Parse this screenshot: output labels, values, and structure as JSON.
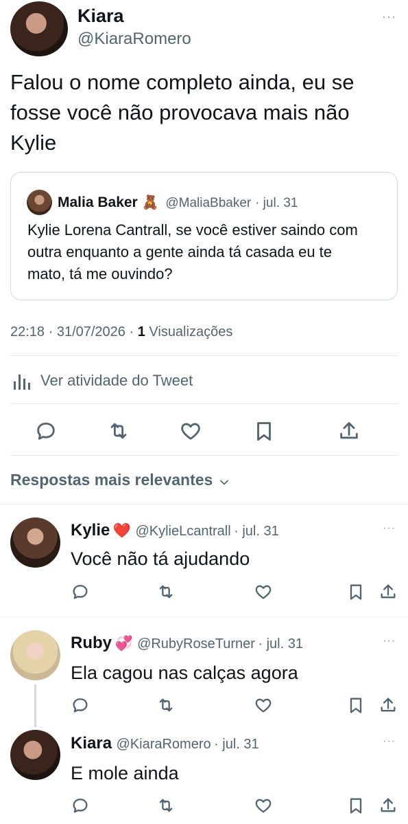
{
  "main_tweet": {
    "author_name": "Kiara",
    "author_handle": "@KiaraRomero",
    "text": "Falou o nome completo ainda, eu se fosse você não provocava mais não Kylie",
    "quoted": {
      "author_name": "Malia Baker",
      "author_emoji": "🧸",
      "author_handle": "@MaliaBbaker",
      "date": "· jul. 31",
      "text": "Kylie Lorena Cantrall, se você estiver saindo com outra enquanto a gente ainda tá casada eu te mato, tá me ouvindo?"
    },
    "timestamp": "22:18 · 31/07/2026 ·",
    "views_count": "1",
    "views_label": "Visualizações",
    "activity_label": "Ver atividade do Tweet"
  },
  "replies_header": "Respostas mais relevantes",
  "replies": [
    {
      "name": "Kylie",
      "emoji": "❤️",
      "handle": "@KylieLcantrall",
      "date": "· jul. 31",
      "text": "Você não tá ajudando"
    },
    {
      "name": "Ruby",
      "emoji": "💞",
      "handle": "@RubyRoseTurner",
      "date": "· jul. 31",
      "text": "Ela cagou nas calças agora"
    },
    {
      "name": "Kiara",
      "emoji": "",
      "handle": "@KiaraRomero",
      "date": "· jul. 31",
      "text": "E mole ainda"
    }
  ],
  "more_label": "···",
  "icons": [
    "reply-icon",
    "retweet-icon",
    "like-icon",
    "bookmark-icon",
    "share-icon",
    "analytics-icon",
    "chevron-down-icon"
  ],
  "colors": {
    "text": "#0f1419",
    "muted": "#536471",
    "border": "#eff3f4",
    "heart": "#e0245e"
  }
}
